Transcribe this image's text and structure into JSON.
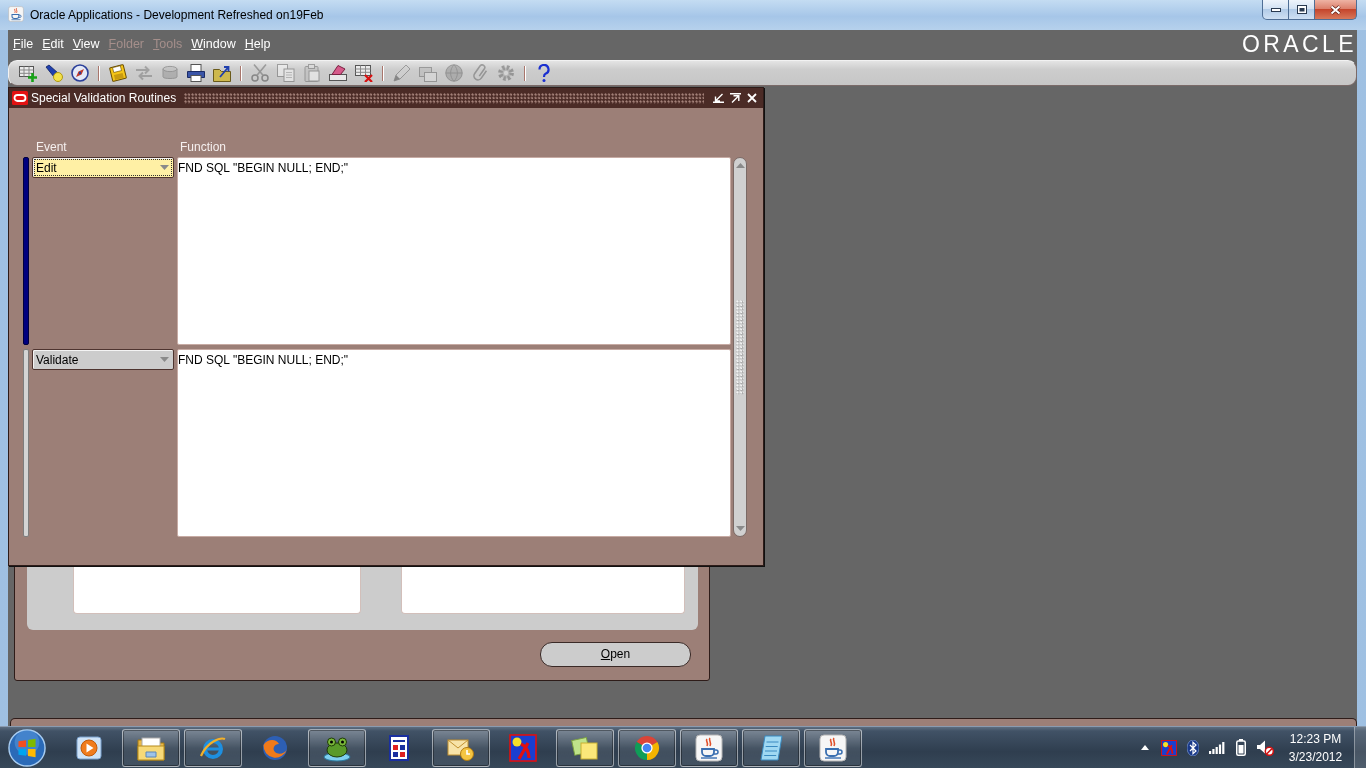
{
  "window": {
    "title": "Oracle Applications - Development Refreshed on19Feb"
  },
  "menu": [
    {
      "label": "File",
      "disabled": false
    },
    {
      "label": "Edit",
      "disabled": false
    },
    {
      "label": "View",
      "disabled": false
    },
    {
      "label": "Folder",
      "disabled": true
    },
    {
      "label": "Tools",
      "disabled": true
    },
    {
      "label": "Window",
      "disabled": false
    },
    {
      "label": "Help",
      "disabled": false
    }
  ],
  "logo": "ORACLE",
  "toolbar": [
    {
      "kind": "button",
      "disabled": false
    },
    {
      "kind": "button",
      "disabled": false
    },
    {
      "kind": "button",
      "disabled": false
    },
    {
      "kind": "separator"
    },
    {
      "kind": "button",
      "disabled": false
    },
    {
      "kind": "button",
      "disabled": true
    },
    {
      "kind": "button",
      "disabled": true
    },
    {
      "kind": "button",
      "disabled": false
    },
    {
      "kind": "button",
      "disabled": false
    },
    {
      "kind": "separator"
    },
    {
      "kind": "button",
      "disabled": true
    },
    {
      "kind": "button",
      "disabled": true
    },
    {
      "kind": "button",
      "disabled": true
    },
    {
      "kind": "button",
      "disabled": false
    },
    {
      "kind": "button",
      "disabled": false
    },
    {
      "kind": "separator"
    },
    {
      "kind": "button",
      "disabled": true
    },
    {
      "kind": "button",
      "disabled": true
    },
    {
      "kind": "button",
      "disabled": true
    },
    {
      "kind": "button",
      "disabled": true
    },
    {
      "kind": "button",
      "disabled": true
    },
    {
      "kind": "separator"
    },
    {
      "kind": "button",
      "disabled": false
    }
  ],
  "form": {
    "title": "Special Validation Routines",
    "columns": [
      "Event",
      "Function"
    ],
    "rows": [
      {
        "event": "Edit",
        "function": "FND SQL \"BEGIN NULL; END;\"",
        "selected": true
      },
      {
        "event": "Validate",
        "function": "FND SQL \"BEGIN NULL; END;\"",
        "selected": false
      }
    ]
  },
  "background_form": {
    "button": "Open"
  },
  "taskbar": {
    "apps": [
      {
        "running": false
      },
      {
        "running": true
      },
      {
        "running": true
      },
      {
        "running": false
      },
      {
        "running": true
      },
      {
        "running": false
      },
      {
        "running": true
      },
      {
        "running": false
      },
      {
        "running": true
      },
      {
        "running": true
      },
      {
        "running": true
      },
      {
        "running": true
      },
      {
        "running": true
      }
    ],
    "clock": {
      "time": "12:23 PM",
      "date": "3/23/2012"
    }
  }
}
